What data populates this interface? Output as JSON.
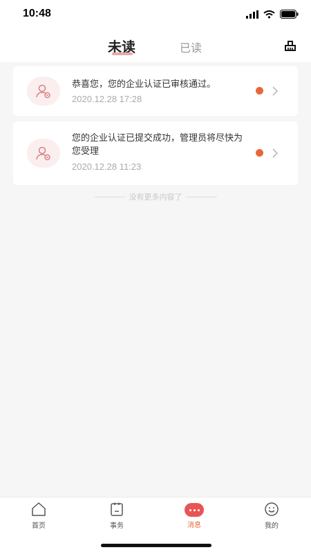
{
  "status_bar": {
    "time": "10:48"
  },
  "header": {
    "tab_unread": "未读",
    "tab_read": "已读"
  },
  "messages": [
    {
      "text": "恭喜您，您的企业认证已审核通过。",
      "time": "2020.12.28 17:28"
    },
    {
      "text": "您的企业认证已提交成功，管理员将尽快为您受理",
      "time": "2020.12.28 11:23"
    }
  ],
  "list_footer": "没有更多内容了",
  "tabbar": {
    "items": [
      {
        "label": "首页",
        "icon": "home-icon"
      },
      {
        "label": "事务",
        "icon": "affairs-icon"
      },
      {
        "label": "消息",
        "icon": "message-icon",
        "active": true
      },
      {
        "label": "我的",
        "icon": "profile-icon"
      }
    ]
  },
  "colors": {
    "accent": "#e8673a",
    "unread_dot": "#e8673a",
    "avatar_bg": "#fbeeee",
    "tab_underline": "#e8a9a9"
  }
}
